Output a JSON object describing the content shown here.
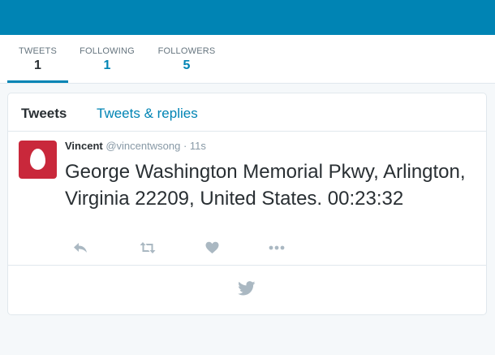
{
  "stats": [
    {
      "label": "TWEETS",
      "value": "1"
    },
    {
      "label": "FOLLOWING",
      "value": "1"
    },
    {
      "label": "FOLLOWERS",
      "value": "5"
    }
  ],
  "tabs": {
    "active": "Tweets",
    "other": "Tweets & replies"
  },
  "tweet": {
    "name": "Vincent",
    "handle": "@vincentwsong",
    "separator": "·",
    "time": "11s",
    "text": "George Washington Memorial Pkwy, Arlington, Virginia 22209, United States. 00:23:32"
  },
  "icons": {
    "reply": "reply-icon",
    "retweet": "retweet-icon",
    "like": "heart-icon",
    "more": "more-icon",
    "footer": "twitter-bird-icon"
  },
  "colors": {
    "brand": "#0084b4",
    "avatar": "#c9283b",
    "icon": "#aab8c2"
  }
}
